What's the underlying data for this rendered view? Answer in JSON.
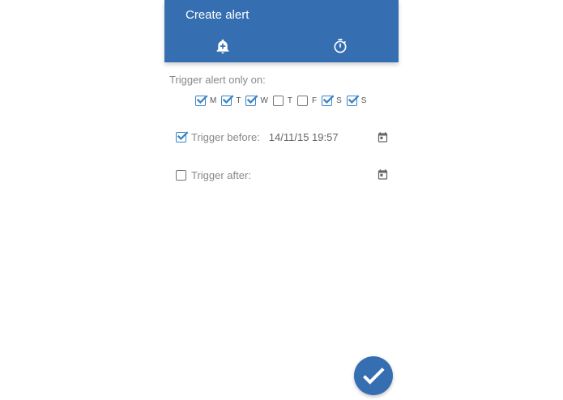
{
  "appbar": {
    "title": "Create alert",
    "tabs": [
      {
        "icon": "add-alert-icon"
      },
      {
        "icon": "timer-icon"
      }
    ]
  },
  "days_section": {
    "label": "Trigger alert only on:",
    "days": [
      {
        "letter": "M",
        "checked": true
      },
      {
        "letter": "T",
        "checked": true
      },
      {
        "letter": "W",
        "checked": true
      },
      {
        "letter": "T",
        "checked": false
      },
      {
        "letter": "F",
        "checked": false
      },
      {
        "letter": "S",
        "checked": true
      },
      {
        "letter": "S",
        "checked": true
      }
    ]
  },
  "trigger_before": {
    "label": "Trigger before:",
    "checked": true,
    "value": "14/11/15 19:57"
  },
  "trigger_after": {
    "label": "Trigger after:",
    "checked": false,
    "value": ""
  },
  "colors": {
    "primary": "#356eb1",
    "checkbox": "#3b84c4"
  },
  "fab": {
    "icon": "check-icon"
  }
}
